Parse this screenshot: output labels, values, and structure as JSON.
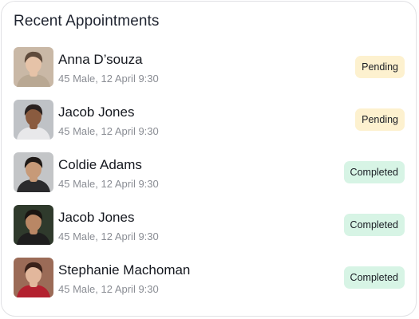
{
  "card": {
    "title": "Recent Appointments"
  },
  "appointments": [
    {
      "name": "Anna D’souza",
      "meta": "45 Male, 12 April 9:30",
      "status": "Pending",
      "status_type": "pending",
      "avatar_palette": {
        "bg": "#c9b8a6",
        "hair": "#5e4a3b",
        "skin": "#e6c3a8",
        "cloth": "#b9a893"
      }
    },
    {
      "name": "Jacob Jones",
      "meta": "45 Male, 12 April 9:30",
      "status": "Pending",
      "status_type": "pending",
      "avatar_palette": {
        "bg": "#bfc2c6",
        "hair": "#2a2220",
        "skin": "#8a5b3f",
        "cloth": "#e8e8ea"
      }
    },
    {
      "name": "Coldie Adams",
      "meta": "45 Male, 12 April 9:30",
      "status": "Completed",
      "status_type": "completed",
      "avatar_palette": {
        "bg": "#c3c5c7",
        "hair": "#1f1a17",
        "skin": "#c79a78",
        "cloth": "#2b2b2d"
      }
    },
    {
      "name": "Jacob Jones",
      "meta": "45 Male, 12 April 9:30",
      "status": "Completed",
      "status_type": "completed",
      "avatar_palette": {
        "bg": "#2f3a2c",
        "hair": "#1a1512",
        "skin": "#b98765",
        "cloth": "#1e1e1e"
      }
    },
    {
      "name": "Stephanie Machoman",
      "meta": "45 Male, 12 April 9:30",
      "status": "Completed",
      "status_type": "completed",
      "avatar_palette": {
        "bg": "#9b6b57",
        "hair": "#3a2119",
        "skin": "#e2b79c",
        "cloth": "#b3212f"
      }
    }
  ],
  "colors": {
    "pending_badge_bg": "#fdf1cf",
    "completed_badge_bg": "#d7f4e5",
    "title_text": "#1f2430",
    "meta_text": "#8a8d94"
  }
}
